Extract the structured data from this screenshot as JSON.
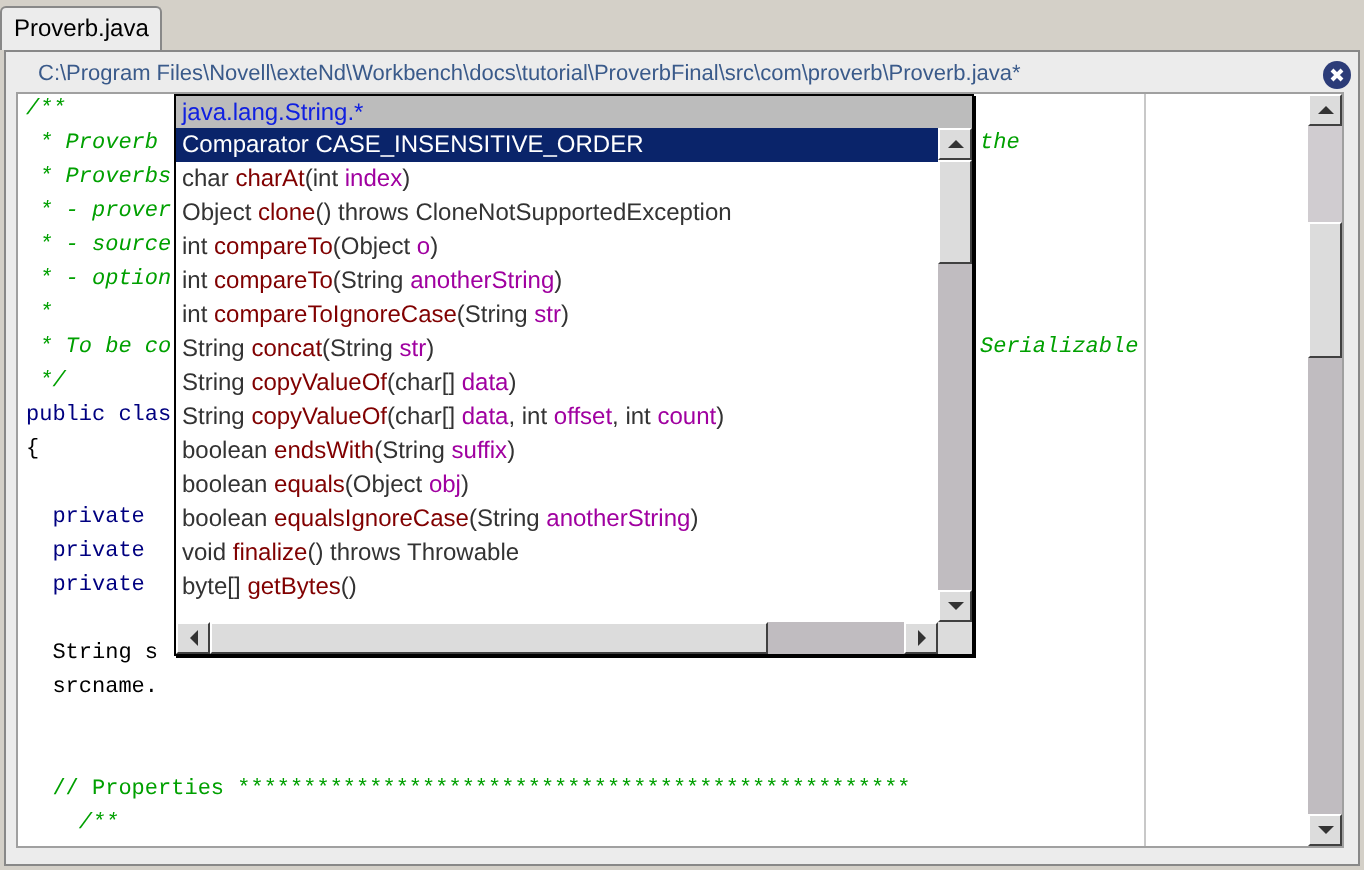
{
  "tab": {
    "label": "Proverb.java",
    "selected": true
  },
  "editor": {
    "path": "C:\\Program Files\\Novell\\exteNd\\Workbench\\docs\\tutorial\\ProverbFinal\\src\\com\\proverb\\Proverb.java*",
    "lines": [
      {
        "kind": "doc",
        "text": "/**"
      },
      {
        "kind": "doc",
        "text": " * Proverb",
        "tail": "the"
      },
      {
        "kind": "doc",
        "text": " * Proverbs"
      },
      {
        "kind": "doc",
        "text": " * - prover"
      },
      {
        "kind": "doc",
        "text": " * - source"
      },
      {
        "kind": "doc",
        "text": " * - option"
      },
      {
        "kind": "doc",
        "text": " *"
      },
      {
        "kind": "doc",
        "text": " * To be co",
        "tail": "Serializable"
      },
      {
        "kind": "doc",
        "text": " */"
      },
      {
        "kind": "keyword",
        "text": "public clas"
      },
      {
        "kind": "plain",
        "text": "{"
      },
      {
        "kind": "blank"
      },
      {
        "kind": "keyword",
        "text": "  private"
      },
      {
        "kind": "keyword",
        "text": "  private"
      },
      {
        "kind": "keyword",
        "text": "  private"
      },
      {
        "kind": "blank"
      },
      {
        "kind": "plain",
        "text": "  String s"
      },
      {
        "kind": "plain",
        "text": "  srcname."
      },
      {
        "kind": "blank"
      },
      {
        "kind": "blank"
      },
      {
        "kind": "comment",
        "text": "  // Properties ***************************************************"
      },
      {
        "kind": "doc",
        "text": "    /**"
      }
    ]
  },
  "popup": {
    "header": "java.lang.String.*",
    "items": [
      {
        "selected": true,
        "parts": [
          {
            "kind": "type",
            "text": "Comparator "
          },
          {
            "kind": "name",
            "text": "CASE_INSENSITIVE_ORDER"
          }
        ]
      },
      {
        "selected": false,
        "parts": [
          {
            "kind": "type",
            "text": "char "
          },
          {
            "kind": "name",
            "text": "charAt"
          },
          {
            "kind": "type",
            "text": "(int "
          },
          {
            "kind": "param",
            "text": "index"
          },
          {
            "kind": "type",
            "text": ")"
          }
        ]
      },
      {
        "selected": false,
        "parts": [
          {
            "kind": "type",
            "text": "Object "
          },
          {
            "kind": "name",
            "text": "clone"
          },
          {
            "kind": "type",
            "text": "() throws CloneNotSupportedException"
          }
        ]
      },
      {
        "selected": false,
        "parts": [
          {
            "kind": "type",
            "text": "int "
          },
          {
            "kind": "name",
            "text": "compareTo"
          },
          {
            "kind": "type",
            "text": "(Object "
          },
          {
            "kind": "param",
            "text": "o"
          },
          {
            "kind": "type",
            "text": ")"
          }
        ]
      },
      {
        "selected": false,
        "parts": [
          {
            "kind": "type",
            "text": "int "
          },
          {
            "kind": "name",
            "text": "compareTo"
          },
          {
            "kind": "type",
            "text": "(String "
          },
          {
            "kind": "param",
            "text": "anotherString"
          },
          {
            "kind": "type",
            "text": ")"
          }
        ]
      },
      {
        "selected": false,
        "parts": [
          {
            "kind": "type",
            "text": "int "
          },
          {
            "kind": "name",
            "text": "compareToIgnoreCase"
          },
          {
            "kind": "type",
            "text": "(String "
          },
          {
            "kind": "param",
            "text": "str"
          },
          {
            "kind": "type",
            "text": ")"
          }
        ]
      },
      {
        "selected": false,
        "parts": [
          {
            "kind": "type",
            "text": "String "
          },
          {
            "kind": "name",
            "text": "concat"
          },
          {
            "kind": "type",
            "text": "(String "
          },
          {
            "kind": "param",
            "text": "str"
          },
          {
            "kind": "type",
            "text": ")"
          }
        ]
      },
      {
        "selected": false,
        "parts": [
          {
            "kind": "type",
            "text": "String "
          },
          {
            "kind": "name",
            "text": "copyValueOf"
          },
          {
            "kind": "type",
            "text": "(char[] "
          },
          {
            "kind": "param",
            "text": "data"
          },
          {
            "kind": "type",
            "text": ")"
          }
        ]
      },
      {
        "selected": false,
        "parts": [
          {
            "kind": "type",
            "text": "String "
          },
          {
            "kind": "name",
            "text": "copyValueOf"
          },
          {
            "kind": "type",
            "text": "(char[] "
          },
          {
            "kind": "param",
            "text": "data"
          },
          {
            "kind": "type",
            "text": ", int "
          },
          {
            "kind": "param",
            "text": "offset"
          },
          {
            "kind": "type",
            "text": ", int "
          },
          {
            "kind": "param",
            "text": "count"
          },
          {
            "kind": "type",
            "text": ")"
          }
        ]
      },
      {
        "selected": false,
        "parts": [
          {
            "kind": "type",
            "text": "boolean "
          },
          {
            "kind": "name",
            "text": "endsWith"
          },
          {
            "kind": "type",
            "text": "(String "
          },
          {
            "kind": "param",
            "text": "suffix"
          },
          {
            "kind": "type",
            "text": ")"
          }
        ]
      },
      {
        "selected": false,
        "parts": [
          {
            "kind": "type",
            "text": "boolean "
          },
          {
            "kind": "name",
            "text": "equals"
          },
          {
            "kind": "type",
            "text": "(Object "
          },
          {
            "kind": "param",
            "text": "obj"
          },
          {
            "kind": "type",
            "text": ")"
          }
        ]
      },
      {
        "selected": false,
        "parts": [
          {
            "kind": "type",
            "text": "boolean "
          },
          {
            "kind": "name",
            "text": "equalsIgnoreCase"
          },
          {
            "kind": "type",
            "text": "(String "
          },
          {
            "kind": "param",
            "text": "anotherString"
          },
          {
            "kind": "type",
            "text": ")"
          }
        ]
      },
      {
        "selected": false,
        "parts": [
          {
            "kind": "type",
            "text": "void "
          },
          {
            "kind": "name",
            "text": "finalize"
          },
          {
            "kind": "type",
            "text": "() throws Throwable"
          }
        ]
      },
      {
        "selected": false,
        "parts": [
          {
            "kind": "type",
            "text": "byte[] "
          },
          {
            "kind": "name",
            "text": "getBytes"
          },
          {
            "kind": "type",
            "text": "()"
          }
        ]
      }
    ]
  }
}
